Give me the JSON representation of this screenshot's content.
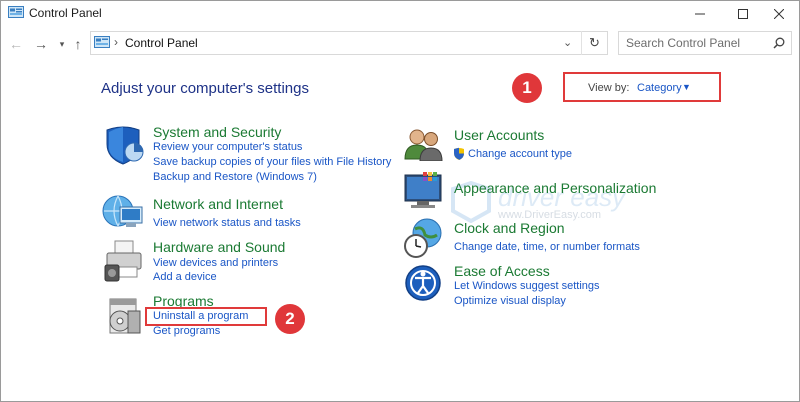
{
  "window": {
    "title": "Control Panel",
    "controls": [
      "minimize-icon",
      "maximize-icon",
      "close-icon"
    ]
  },
  "address_bar": {
    "path_label": "Control Panel",
    "search_placeholder": "Search Control Panel"
  },
  "main": {
    "heading": "Adjust your computer's settings",
    "view_by": {
      "label": "View by:",
      "value": "Category"
    },
    "markers": [
      "1",
      "2"
    ],
    "categories_left": [
      {
        "title": "System and Security",
        "icon": "shield-icon",
        "links": [
          "Review your computer's status",
          "Save backup copies of your files with File History",
          "Backup and Restore (Windows 7)"
        ]
      },
      {
        "title": "Network and Internet",
        "icon": "network-icon",
        "links": [
          "View network status and tasks"
        ]
      },
      {
        "title": "Hardware and Sound",
        "icon": "printer-icon",
        "links": [
          "View devices and printers",
          "Add a device"
        ]
      },
      {
        "title": "Programs",
        "icon": "programs-icon",
        "links": [
          "Uninstall a program",
          "Get programs"
        ]
      }
    ],
    "categories_right": [
      {
        "title": "User Accounts",
        "icon": "users-icon",
        "links": [
          "Change account type"
        ]
      },
      {
        "title": "Appearance and Personalization",
        "icon": "monitor-icon",
        "links": []
      },
      {
        "title": "Clock and Region",
        "icon": "clock-globe-icon",
        "links": [
          "Change date, time, or number formats"
        ]
      },
      {
        "title": "Ease of Access",
        "icon": "accessibility-icon",
        "links": [
          "Let Windows suggest settings",
          "Optimize visual display"
        ]
      }
    ]
  },
  "watermark": {
    "brand": "driver easy",
    "url": "www.DriverEasy.com"
  },
  "colors": {
    "category_green": "#1b7a33",
    "link_blue": "#1a56c6",
    "heading_blue": "#1e3287",
    "highlight_red": "#e03a3a"
  }
}
